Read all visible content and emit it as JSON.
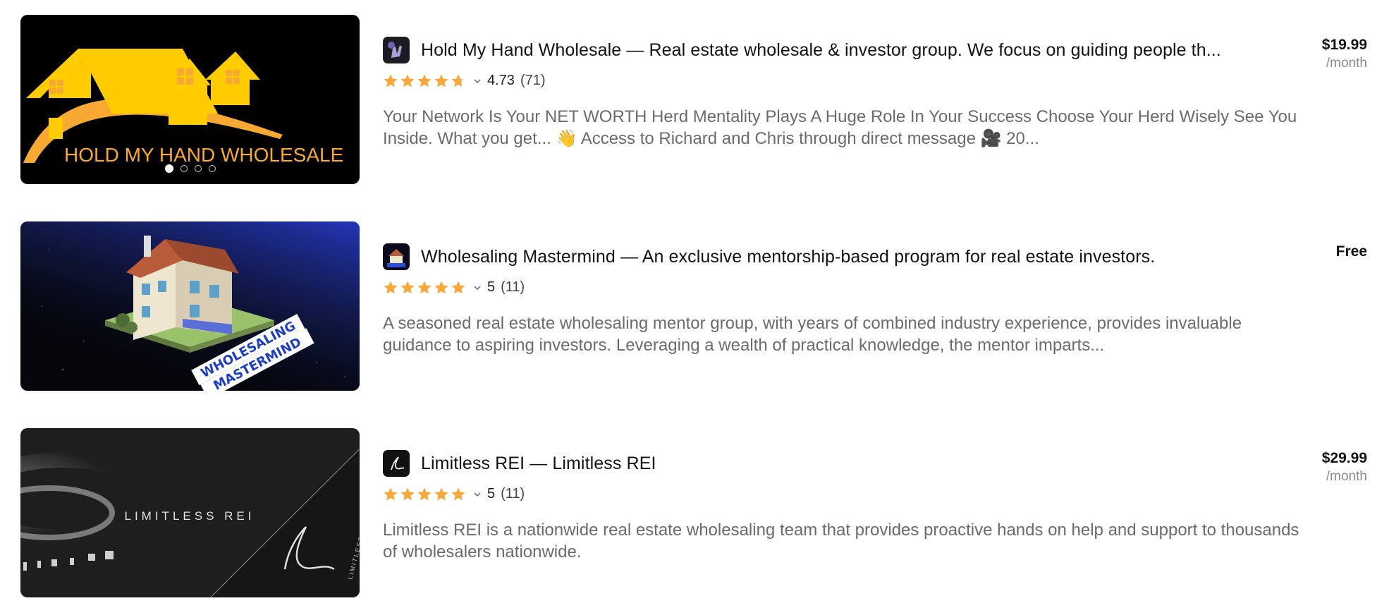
{
  "listings": [
    {
      "title": "Hold My Hand Wholesale — Real estate wholesale & investor group. We focus on guiding people th...",
      "rating": "4.73",
      "reviews": "(71)",
      "stars_fraction": 0.946,
      "description": "Your Network Is Your NET WORTH Herd Mentality Plays A Huge Role In Your Success Choose Your Herd Wisely See You Inside. What you get... 👋 Access to Richard and Chris through direct message 🎥 20...",
      "price": "$19.99",
      "period": "/month",
      "image_text": "HOLD MY HAND WHOLESALE",
      "carousel_pages": 4,
      "carousel_active": 1,
      "avatar_icon": "hand-logo-icon"
    },
    {
      "title": "Wholesaling Mastermind — An exclusive mentorship-based program for real estate investors.",
      "rating": "5",
      "reviews": "(11)",
      "stars_fraction": 1,
      "description": "A seasoned real estate wholesaling mentor group, with years of combined industry experience, provides invaluable guidance to aspiring investors. Leveraging a wealth of practical knowledge, the mentor imparts...",
      "price": "Free",
      "period": "",
      "image_text_line1": "WHOLESALING",
      "image_text_line2": "MASTERMIND",
      "avatar_icon": "house-logo-icon"
    },
    {
      "title": "Limitless REI — Limitless REI",
      "rating": "5",
      "reviews": "(11)",
      "stars_fraction": 1,
      "description": "Limitless REI is a nationwide real estate wholesaling team that provides proactive hands on help and support to thousands of wholesalers nationwide.",
      "price": "$29.99",
      "period": "/month",
      "image_text": "LIMITLESS REI",
      "image_text_small": "LIMITLESS",
      "avatar_icon": "signature-logo-icon"
    }
  ],
  "colors": {
    "star": "#f6a83a",
    "star_empty": "#e4e4e4",
    "logo_yellow": "#ffcc00",
    "logo_orange": "#f7a934"
  }
}
